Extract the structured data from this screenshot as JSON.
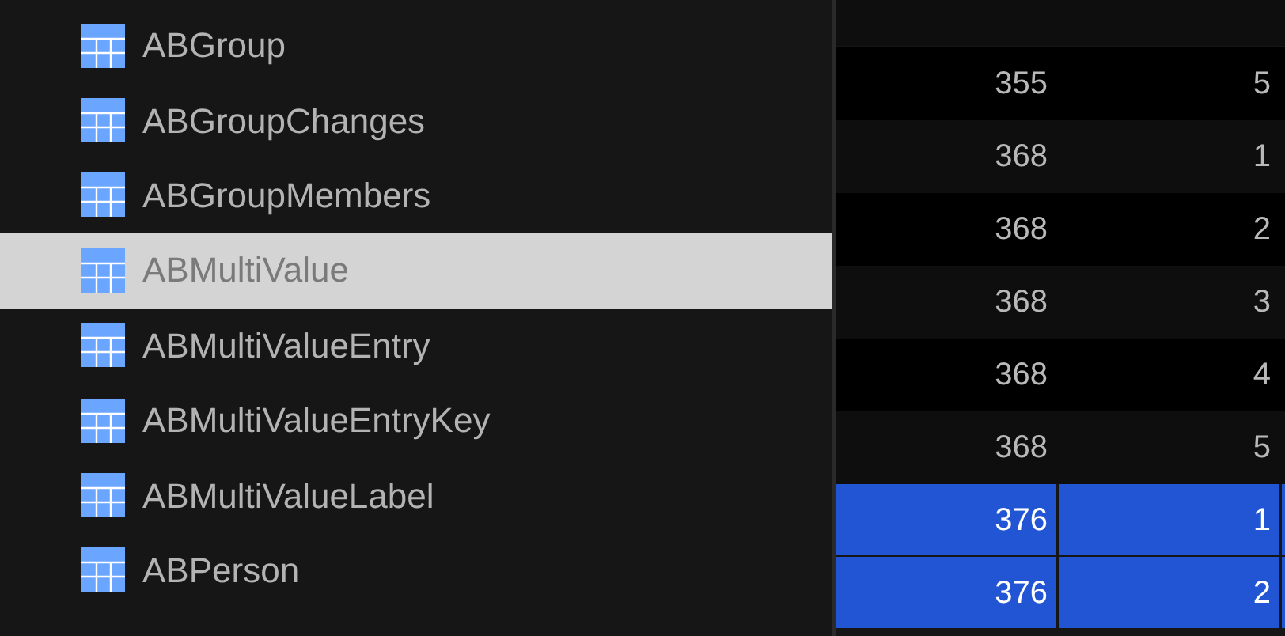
{
  "sidebar": {
    "items": [
      {
        "label": "ABGroup",
        "selected": false
      },
      {
        "label": "ABGroupChanges",
        "selected": false
      },
      {
        "label": "ABGroupMembers",
        "selected": false
      },
      {
        "label": "ABMultiValue",
        "selected": true
      },
      {
        "label": "ABMultiValueEntry",
        "selected": false
      },
      {
        "label": "ABMultiValueEntryKey",
        "selected": false
      },
      {
        "label": "ABMultiValueLabel",
        "selected": false
      },
      {
        "label": "ABPerson",
        "selected": false
      }
    ]
  },
  "table": {
    "rows": [
      {
        "cells": [
          "355",
          "5"
        ],
        "selected": false
      },
      {
        "cells": [
          "368",
          "1"
        ],
        "selected": false
      },
      {
        "cells": [
          "368",
          "2"
        ],
        "selected": false
      },
      {
        "cells": [
          "368",
          "3"
        ],
        "selected": false
      },
      {
        "cells": [
          "368",
          "4"
        ],
        "selected": false
      },
      {
        "cells": [
          "368",
          "5"
        ],
        "selected": false
      },
      {
        "cells": [
          "376",
          "1"
        ],
        "selected": true
      },
      {
        "cells": [
          "376",
          "2"
        ],
        "selected": true
      }
    ]
  }
}
